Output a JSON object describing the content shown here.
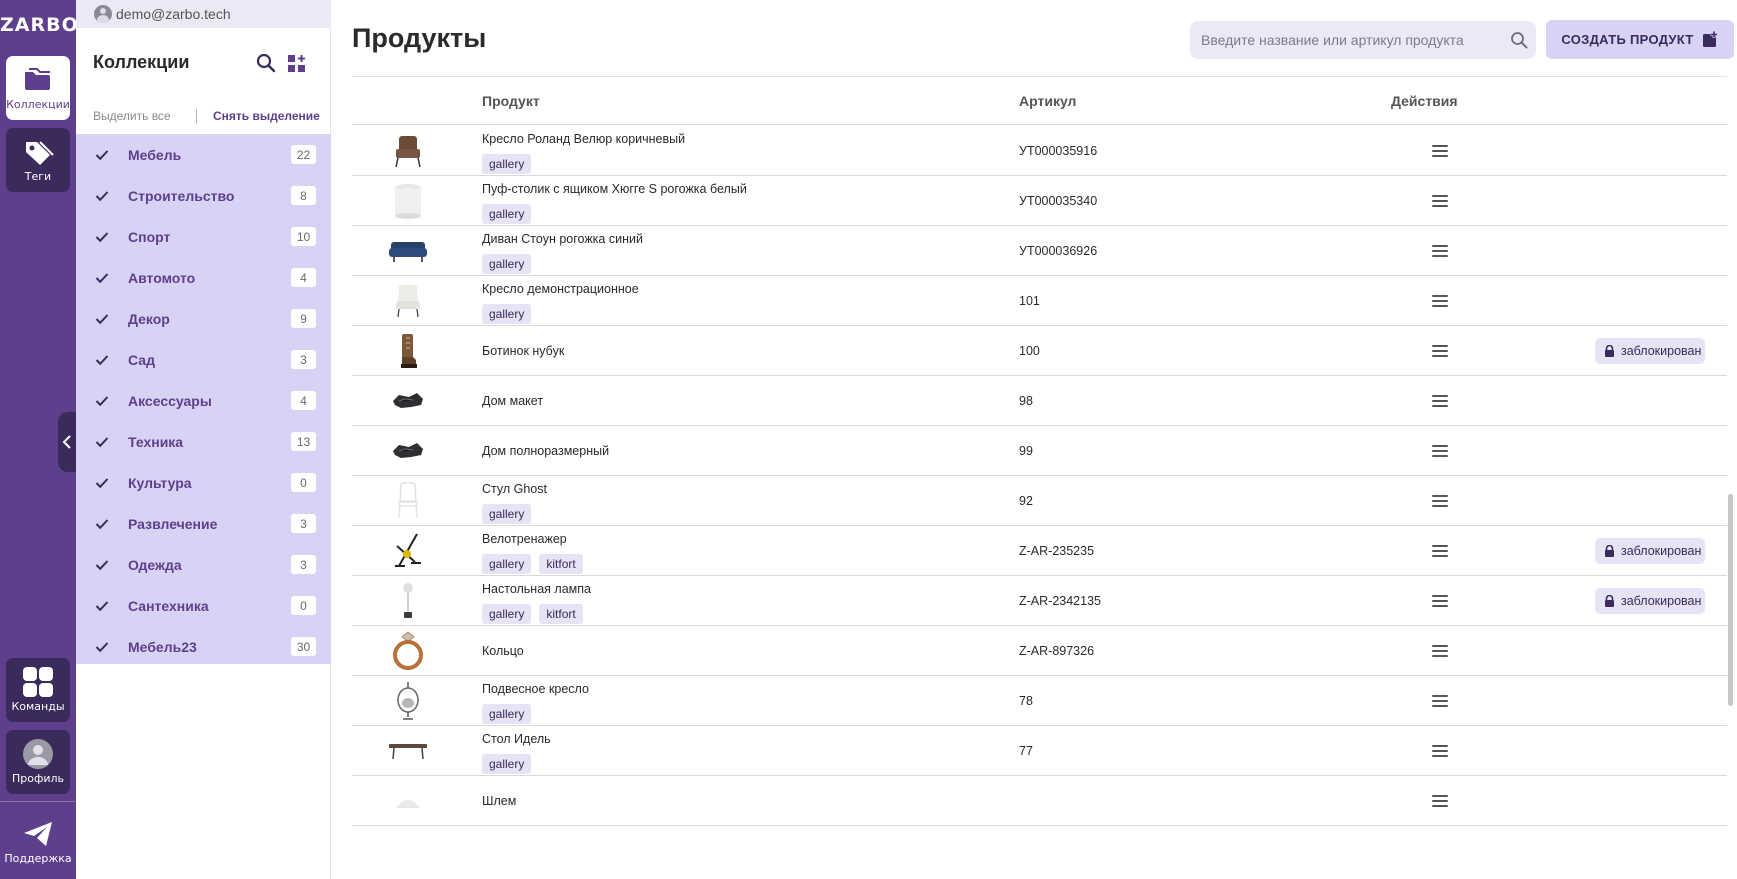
{
  "rail": {
    "logo": "ZARBO",
    "items": [
      {
        "label": "Коллекции",
        "icon": "folder-icon",
        "active": true
      },
      {
        "label": "Теги",
        "icon": "tag-icon",
        "active": false
      }
    ],
    "bottom": [
      {
        "label": "Команды",
        "icon": "grid-icon"
      },
      {
        "label": "Профиль",
        "icon": "user-icon"
      },
      {
        "label": "Поддержка",
        "icon": "send-icon"
      }
    ]
  },
  "panel": {
    "user_email": "demo@zarbo.tech",
    "title": "Коллекции",
    "select_all": "Выделить все",
    "deselect": "Снять выделение",
    "collections": [
      {
        "name": "Мебель",
        "count": "22"
      },
      {
        "name": "Строительство",
        "count": "8"
      },
      {
        "name": "Спорт",
        "count": "10"
      },
      {
        "name": "Автомото",
        "count": "4"
      },
      {
        "name": "Декор",
        "count": "9"
      },
      {
        "name": "Сад",
        "count": "3"
      },
      {
        "name": "Аксессуары",
        "count": "4"
      },
      {
        "name": "Техника",
        "count": "13"
      },
      {
        "name": "Культура",
        "count": "0"
      },
      {
        "name": "Развлечение",
        "count": "3"
      },
      {
        "name": "Одежда",
        "count": "3"
      },
      {
        "name": "Сантехника",
        "count": "0"
      },
      {
        "name": "Мебель23",
        "count": "30"
      }
    ]
  },
  "main": {
    "title": "Продукты",
    "search_placeholder": "Введите название или артикул продукта",
    "create_label": "СОЗДАТЬ ПРОДУКТ",
    "columns": {
      "product": "Продукт",
      "sku": "Артикул",
      "actions": "Действия"
    },
    "locked_label": "заблокирован",
    "products": [
      {
        "name": "Кресло Роланд Велюр коричневый",
        "sku": "УТ000035916",
        "tags": [
          "gallery"
        ],
        "locked": false,
        "thumb": "armchair-brown"
      },
      {
        "name": "Пуф-столик с ящиком Хюгге S рогожка белый",
        "sku": "УТ000035340",
        "tags": [
          "gallery"
        ],
        "locked": false,
        "thumb": "pouf-white"
      },
      {
        "name": "Диван Стоун рогожка синий",
        "sku": "УТ000036926",
        "tags": [
          "gallery"
        ],
        "locked": false,
        "thumb": "sofa-blue"
      },
      {
        "name": "Кресло демонстрационное",
        "sku": "101",
        "tags": [
          "gallery"
        ],
        "locked": false,
        "thumb": "armchair-white"
      },
      {
        "name": "Ботинок нубук",
        "sku": "100",
        "tags": [],
        "locked": true,
        "thumb": "boot"
      },
      {
        "name": "Дом макет",
        "sku": "98",
        "tags": [],
        "locked": false,
        "thumb": "house-model"
      },
      {
        "name": "Дом полноразмерный",
        "sku": "99",
        "tags": [],
        "locked": false,
        "thumb": "house-model"
      },
      {
        "name": "Стул Ghost",
        "sku": "92",
        "tags": [
          "gallery"
        ],
        "locked": false,
        "thumb": "ghost-chair"
      },
      {
        "name": "Велотренажер",
        "sku": "Z-AR-235235",
        "tags": [
          "gallery",
          "kitfort"
        ],
        "locked": true,
        "thumb": "exercise-bike"
      },
      {
        "name": "Настольная лампа",
        "sku": "Z-AR-2342135",
        "tags": [
          "gallery",
          "kitfort"
        ],
        "locked": true,
        "thumb": "lamp"
      },
      {
        "name": "Кольцо",
        "sku": "Z-AR-897326",
        "tags": [],
        "locked": false,
        "thumb": "ring"
      },
      {
        "name": "Подвесное кресло",
        "sku": "78",
        "tags": [
          "gallery"
        ],
        "locked": false,
        "thumb": "hanging-chair"
      },
      {
        "name": "Стол Идель",
        "sku": "77",
        "tags": [
          "gallery"
        ],
        "locked": false,
        "thumb": "table"
      },
      {
        "name": "Шлем",
        "sku": "",
        "tags": [],
        "locked": false,
        "thumb": "helmet"
      }
    ]
  },
  "colors": {
    "rail": "#5e3f8c",
    "rail_button": "#3b2a5c",
    "accent_light": "#d8d3f5",
    "tag_bg": "#e6e3f4"
  }
}
